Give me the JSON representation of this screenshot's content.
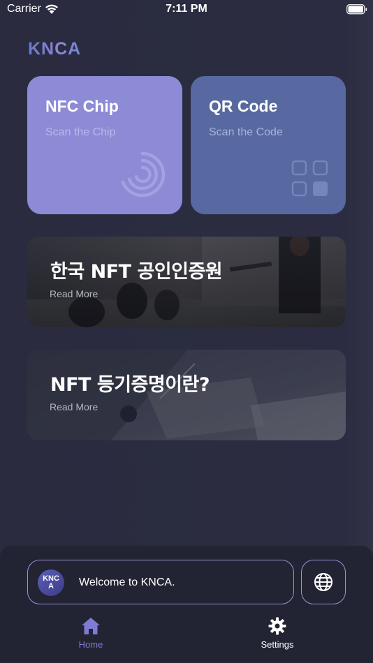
{
  "status_bar": {
    "carrier": "Carrier",
    "time": "7:11 PM",
    "wifi_icon": "wifi-icon",
    "battery_icon": "battery-icon"
  },
  "logo": {
    "text": "KNCA"
  },
  "scan_cards": [
    {
      "title": "NFC Chip",
      "subtitle": "Scan the Chip",
      "icon": "nfc-icon",
      "color": "#8d8bd6"
    },
    {
      "title": "QR Code",
      "subtitle": "Scan the Code",
      "icon": "qr-grid-icon",
      "color": "#5769a0"
    }
  ],
  "articles": [
    {
      "title": "한국 NFT 공인인증원",
      "link": "Read More"
    },
    {
      "title": "NFT 등기증명이란?",
      "link": "Read More"
    }
  ],
  "welcome": {
    "avatar_text": "KNCA",
    "message": "Welcome to KNCA.",
    "language_icon": "globe-icon"
  },
  "tab_bar": {
    "items": [
      {
        "label": "Home",
        "icon": "home-icon",
        "active": true
      },
      {
        "label": "Settings",
        "icon": "gear-icon",
        "active": false
      }
    ]
  },
  "colors": {
    "background": "#2a2b40",
    "accent": "#8d8bd6",
    "active_tab": "#7e7bd4"
  }
}
